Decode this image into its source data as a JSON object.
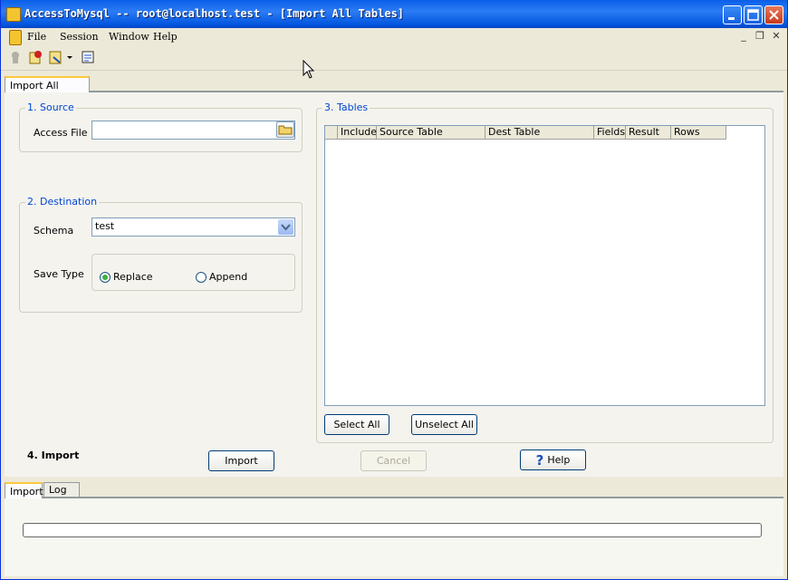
{
  "window": {
    "title": "AccessToMysql -- root@localhost.test - [Import All Tables]"
  },
  "menu": {
    "items": [
      "File",
      "Session",
      "Window",
      "Help"
    ]
  },
  "mdi_controls": [
    "_",
    "❐",
    "✕"
  ],
  "tabs_top": {
    "active": "Import All Tables"
  },
  "source": {
    "group_title": "1. Source",
    "access_file_label": "Access File",
    "access_file_value": ""
  },
  "destination": {
    "group_title": "2. Destination",
    "schema_label": "Schema",
    "schema_value": "test",
    "save_type_label": "Save Type",
    "options": [
      "Replace",
      "Append"
    ],
    "selected": "Replace"
  },
  "tables": {
    "group_title": "3. Tables",
    "columns": [
      "Include",
      "Source Table",
      "Dest Table",
      "Fields",
      "Result",
      "Rows"
    ],
    "rows": [],
    "select_all_label": "Select All",
    "unselect_all_label": "Unselect All"
  },
  "import_section": {
    "label": "4. Import",
    "import_label": "Import",
    "cancel_label": "Cancel",
    "help_label": "Help"
  },
  "tabs_bottom": [
    "Import",
    "Log"
  ],
  "progress": {
    "value": 0
  },
  "colors": {
    "title_blue": "#0a5fe8",
    "group_title": "#0046d5",
    "radio_dot": "#3cb043"
  }
}
